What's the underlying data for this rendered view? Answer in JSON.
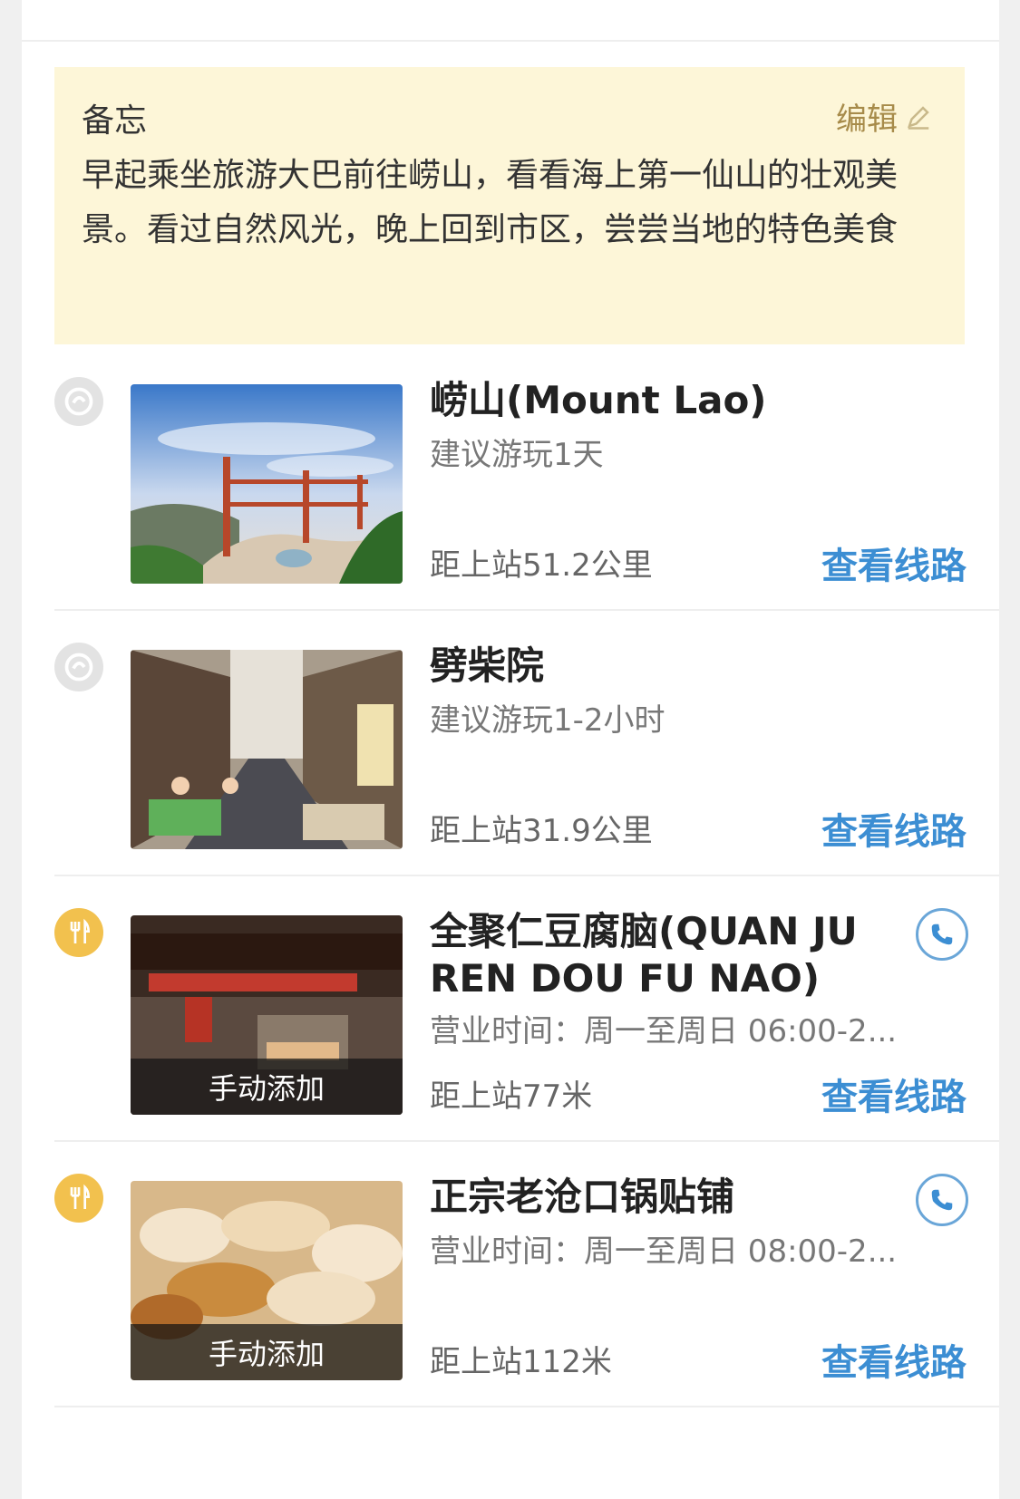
{
  "memo": {
    "title": "备忘",
    "edit_label": "编辑",
    "text": "早起乘坐旅游大巴前往崂山，看看海上第一仙山的壮观美景。看过自然风光，晚上回到市区，尝尝当地的特色美食"
  },
  "items": [
    {
      "type_icon": "sight-icon",
      "name": "崂山(Mount Lao)",
      "sub": "建议游玩1天",
      "distance": "距上站51.2公里",
      "route_label": "查看线路"
    },
    {
      "type_icon": "sight-icon",
      "name": "劈柴院",
      "sub": "建议游玩1-2小时",
      "distance": "距上站31.9公里",
      "route_label": "查看线路"
    },
    {
      "type_icon": "food-icon",
      "name": "全聚仁豆腐脑(QUAN JU REN DOU FU NAO)",
      "sub": "营业时间：周一至周日 06:00-2...",
      "distance": "距上站77米",
      "route_label": "查看线路",
      "badge": "手动添加",
      "has_phone": true
    },
    {
      "type_icon": "food-icon",
      "name": "正宗老沧口锅贴铺",
      "sub": "营业时间：周一至周日 08:00-2...",
      "distance": "距上站112米",
      "route_label": "查看线路",
      "badge": "手动添加",
      "has_phone": true
    }
  ],
  "colors": {
    "memo_bg": "#fdf6d8",
    "edit_text": "#a78b4a",
    "route_link": "#3c8ed3",
    "food_icon_bg": "#f2c14e"
  }
}
